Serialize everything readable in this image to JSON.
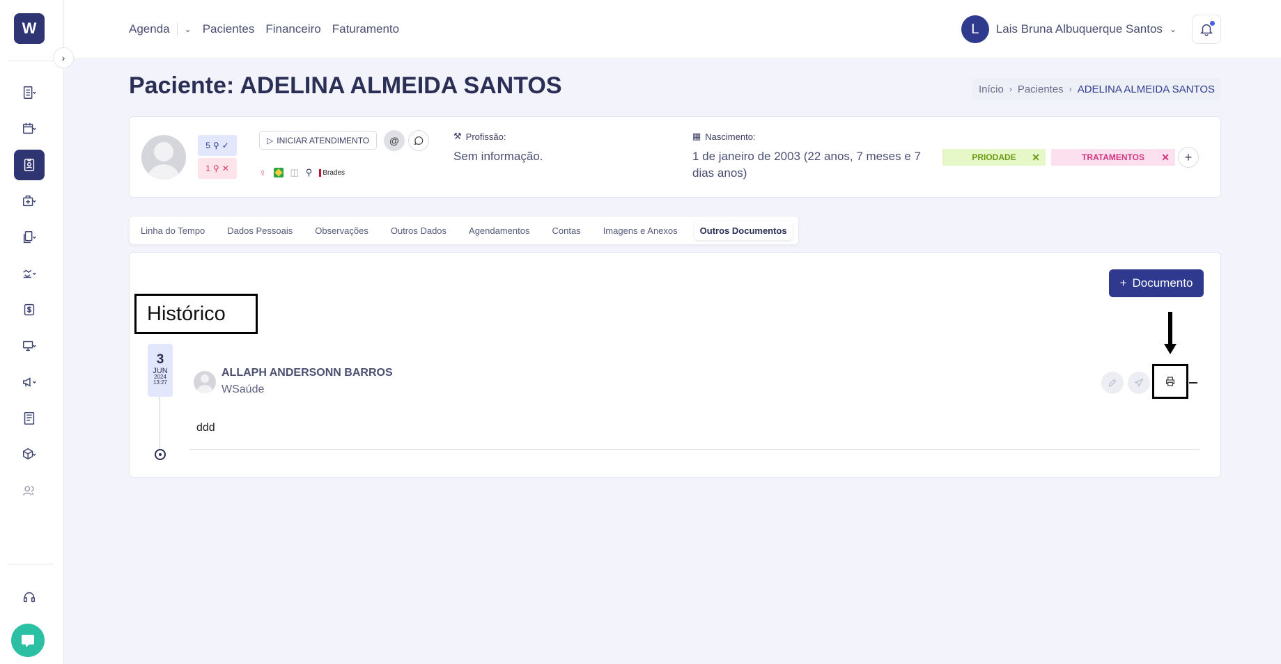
{
  "sidebar": {
    "logo": "W",
    "items": [
      {
        "icon": "list-icon"
      },
      {
        "icon": "calendar-icon"
      },
      {
        "icon": "patient-card-icon"
      },
      {
        "icon": "medical-bag-icon"
      },
      {
        "icon": "documents-icon"
      },
      {
        "icon": "handshake-icon"
      },
      {
        "icon": "dollar-icon"
      },
      {
        "icon": "monitor-icon"
      },
      {
        "icon": "megaphone-icon"
      },
      {
        "icon": "report-icon"
      },
      {
        "icon": "box-icon"
      },
      {
        "icon": "users-icon"
      },
      {
        "icon": "headset-icon"
      }
    ]
  },
  "topnav": {
    "agenda": "Agenda",
    "pacientes": "Pacientes",
    "financeiro": "Financeiro",
    "faturamento": "Faturamento"
  },
  "user": {
    "initial": "L",
    "name": "Lais Bruna Albuquerque Santos"
  },
  "page": {
    "title": "Paciente: ADELINA ALMEIDA SANTOS"
  },
  "breadcrumb": {
    "home": "Início",
    "patients": "Pacientes",
    "current": "ADELINA ALMEIDA SANTOS"
  },
  "patient": {
    "attended_count": "5",
    "missed_count": "1",
    "start_button": "INICIAR ATENDIMENTO",
    "insurance": "Brades",
    "profession_label": "Profissão:",
    "profession_value": "Sem informação.",
    "birth_label": "Nascimento:",
    "birth_value": "1 de janeiro de 2003 (22 anos, 7 meses e 7 dias anos)",
    "tags": [
      "PRIODADE",
      "TRATAMENTOS"
    ]
  },
  "tabs": [
    "Linha do Tempo",
    "Dados Pessoais",
    "Observações",
    "Outros Dados",
    "Agendamentos",
    "Contas",
    "Imagens e Anexos",
    "Outros Documentos"
  ],
  "main": {
    "add_button": "Documento",
    "history_title": "Histórico"
  },
  "entry": {
    "day": "3",
    "month": "JUN",
    "year": "2024",
    "time": "13:27",
    "author": "ALLAPH ANDERSONN BARROS",
    "org": "WSaúde",
    "content": "ddd"
  },
  "colors": {
    "primary": "#2f3a8f",
    "tag_green_bg": "#e6f8c8",
    "tag_pink_bg": "#fde0ee",
    "chat": "#2bbfa4"
  }
}
